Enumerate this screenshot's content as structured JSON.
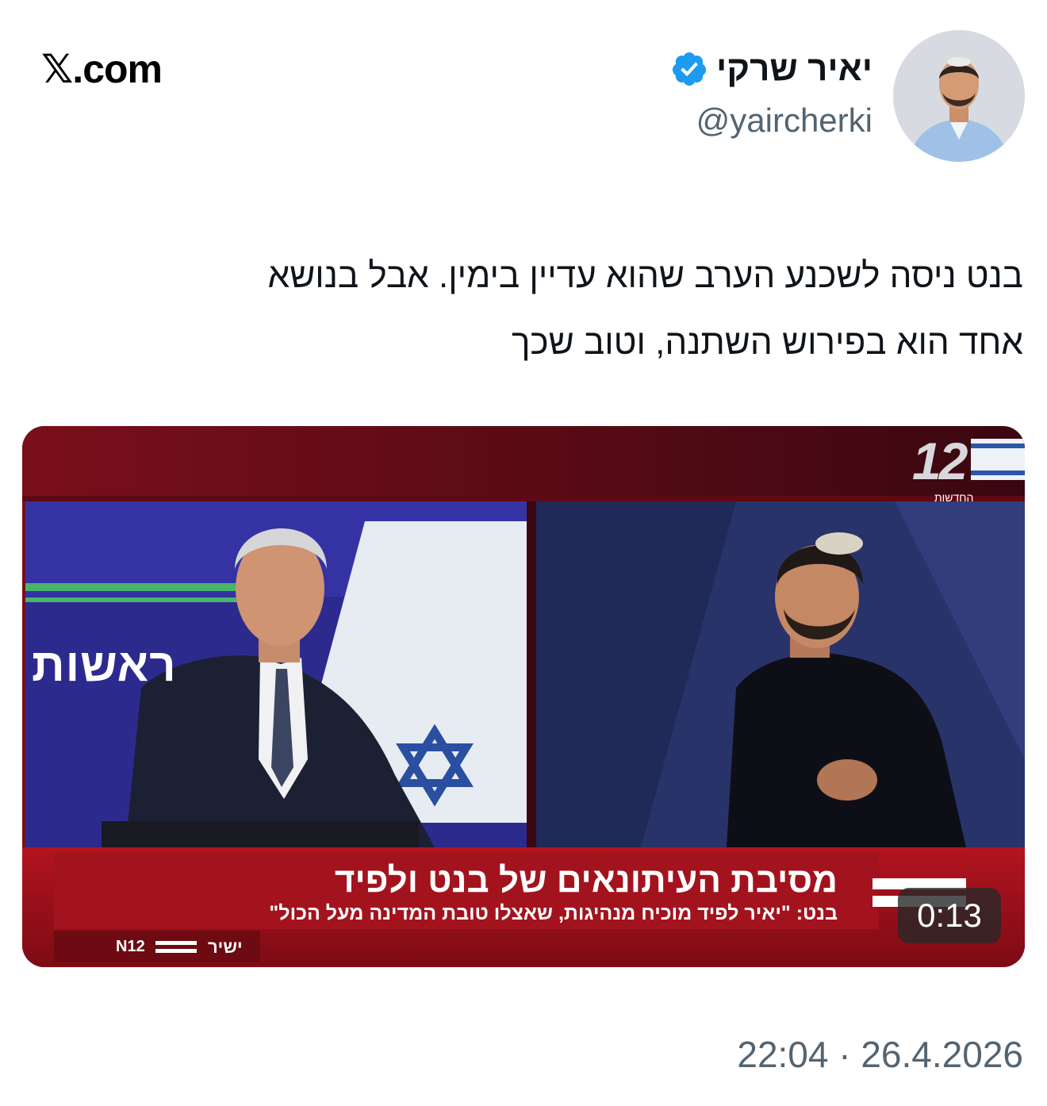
{
  "site": {
    "brand": "com"
  },
  "author": {
    "name": "יאיר שרקי",
    "handle": "@yaircherki",
    "verified": true,
    "verified_color": "#1d9bf0"
  },
  "tweet": {
    "lines": [
      "בנט ניסה לשכנע הערב שהוא עדיין בימין. אבל בנושא",
      "אחד הוא בפירוש השתנה, וטוב שכך"
    ]
  },
  "video": {
    "duration": "0:13",
    "banner_word": "ראשות",
    "headline": "מסיבת העיתונאים של בנט ולפיד",
    "subheadline": "בנט: \"יאיר לפיד מוכיח מנהיגות, שאצלו טובת המדינה מעל הכול\"",
    "live_label": "ישיר",
    "channel_number": "12",
    "channel_sub": "החדשות",
    "logo_small": "N12",
    "ticker_color": "#9c0f1a"
  },
  "timestamp": "22:04 · 26.4.2026"
}
